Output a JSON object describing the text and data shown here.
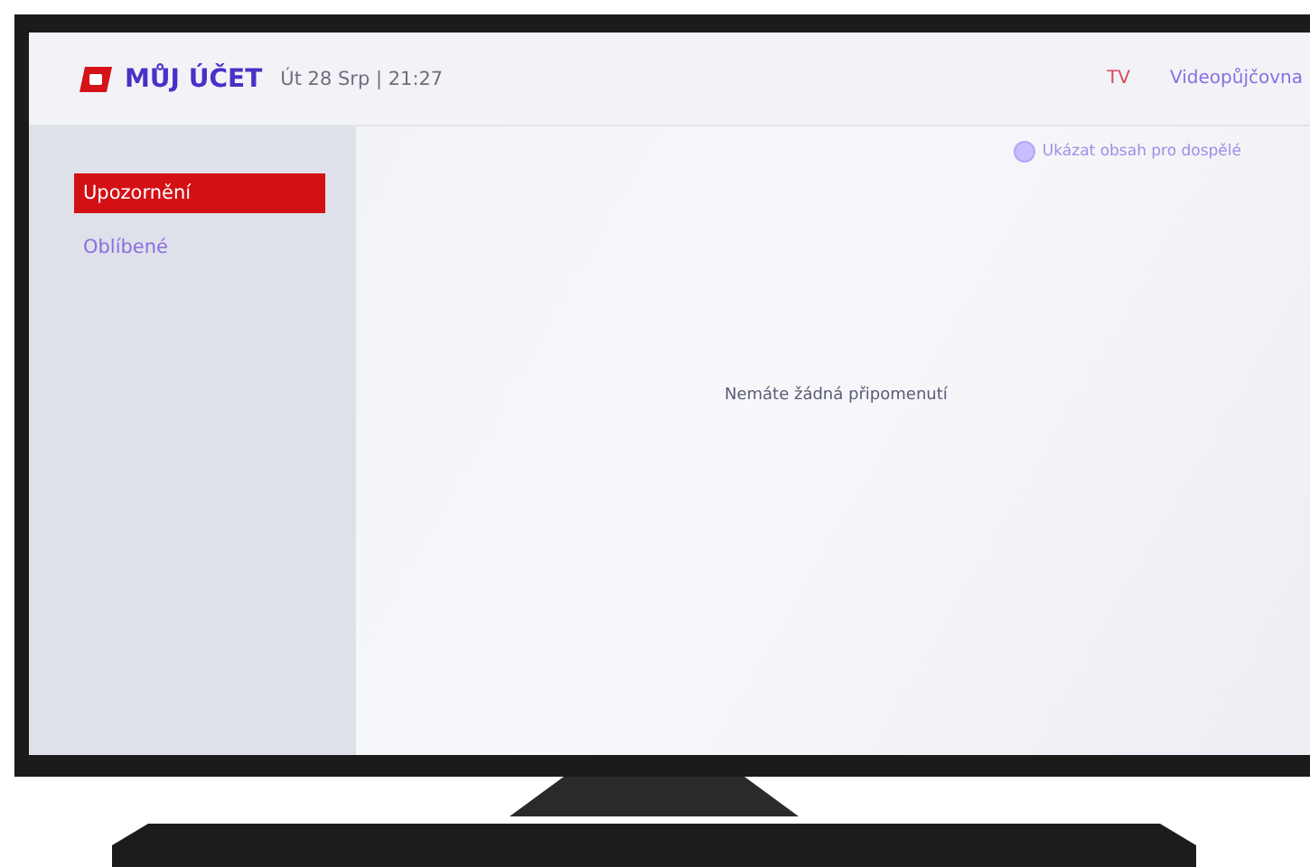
{
  "header": {
    "logo_text": "MŮJ ÚČET",
    "datetime": "Út 28 Srp | 21:27",
    "tabs": [
      {
        "label": "TV",
        "selected": true
      },
      {
        "label": "Videopůjčovna",
        "selected": false
      }
    ]
  },
  "adult_toggle": {
    "label": "Ukázat obsah pro dospělé",
    "on": false
  },
  "sidebar": {
    "items": [
      {
        "label": "Upozornění",
        "selected": true
      },
      {
        "label": "Oblíbené",
        "selected": false
      }
    ]
  },
  "message": "Nemáte žádná připomenutí"
}
